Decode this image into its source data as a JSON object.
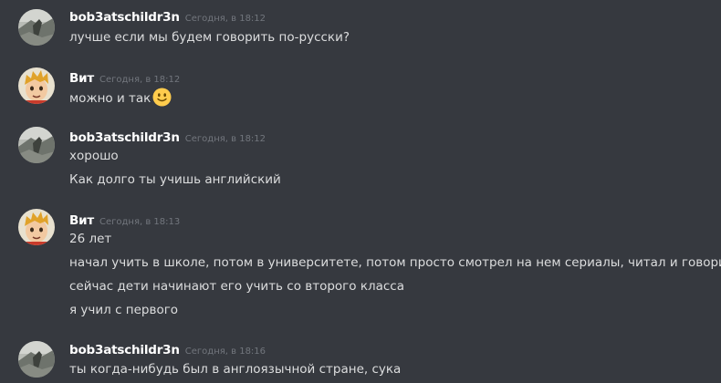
{
  "messages": [
    {
      "author": "bob3atschildr3n",
      "time": "Сегодня, в 18:12",
      "avatar": "landscape-avatar-icon",
      "lines": [
        "лучше если мы будем говорить по-русски?"
      ]
    },
    {
      "author": "Вит",
      "time": "Сегодня, в 18:12",
      "avatar": "cartoon-boy-avatar-icon",
      "lines": [
        "можно и так"
      ],
      "emoji": "slightly-smiling-face-icon"
    },
    {
      "author": "bob3atschildr3n",
      "time": "Сегодня, в 18:12",
      "avatar": "landscape-avatar-icon",
      "lines": [
        "хорошо",
        "Как долго ты учишь английский"
      ]
    },
    {
      "author": "Вит",
      "time": "Сегодня, в 18:13",
      "avatar": "cartoon-boy-avatar-icon",
      "lines": [
        "26 лет",
        "начал учить в школе, потом в университете, потом просто смотрел на нем сериалы, читал и говорил",
        "сейчас дети начинают его учить со второго класса",
        "я учил с первого"
      ]
    },
    {
      "author": "bob3atschildr3n",
      "time": "Сегодня, в 18:16",
      "avatar": "landscape-avatar-icon",
      "lines": [
        "ты когда-нибудь был в англоязычной стране, сука"
      ]
    }
  ],
  "colors": {
    "background": "#36393f",
    "username": "#ffffff",
    "timestamp": "#72767d",
    "text": "#dcddde"
  }
}
